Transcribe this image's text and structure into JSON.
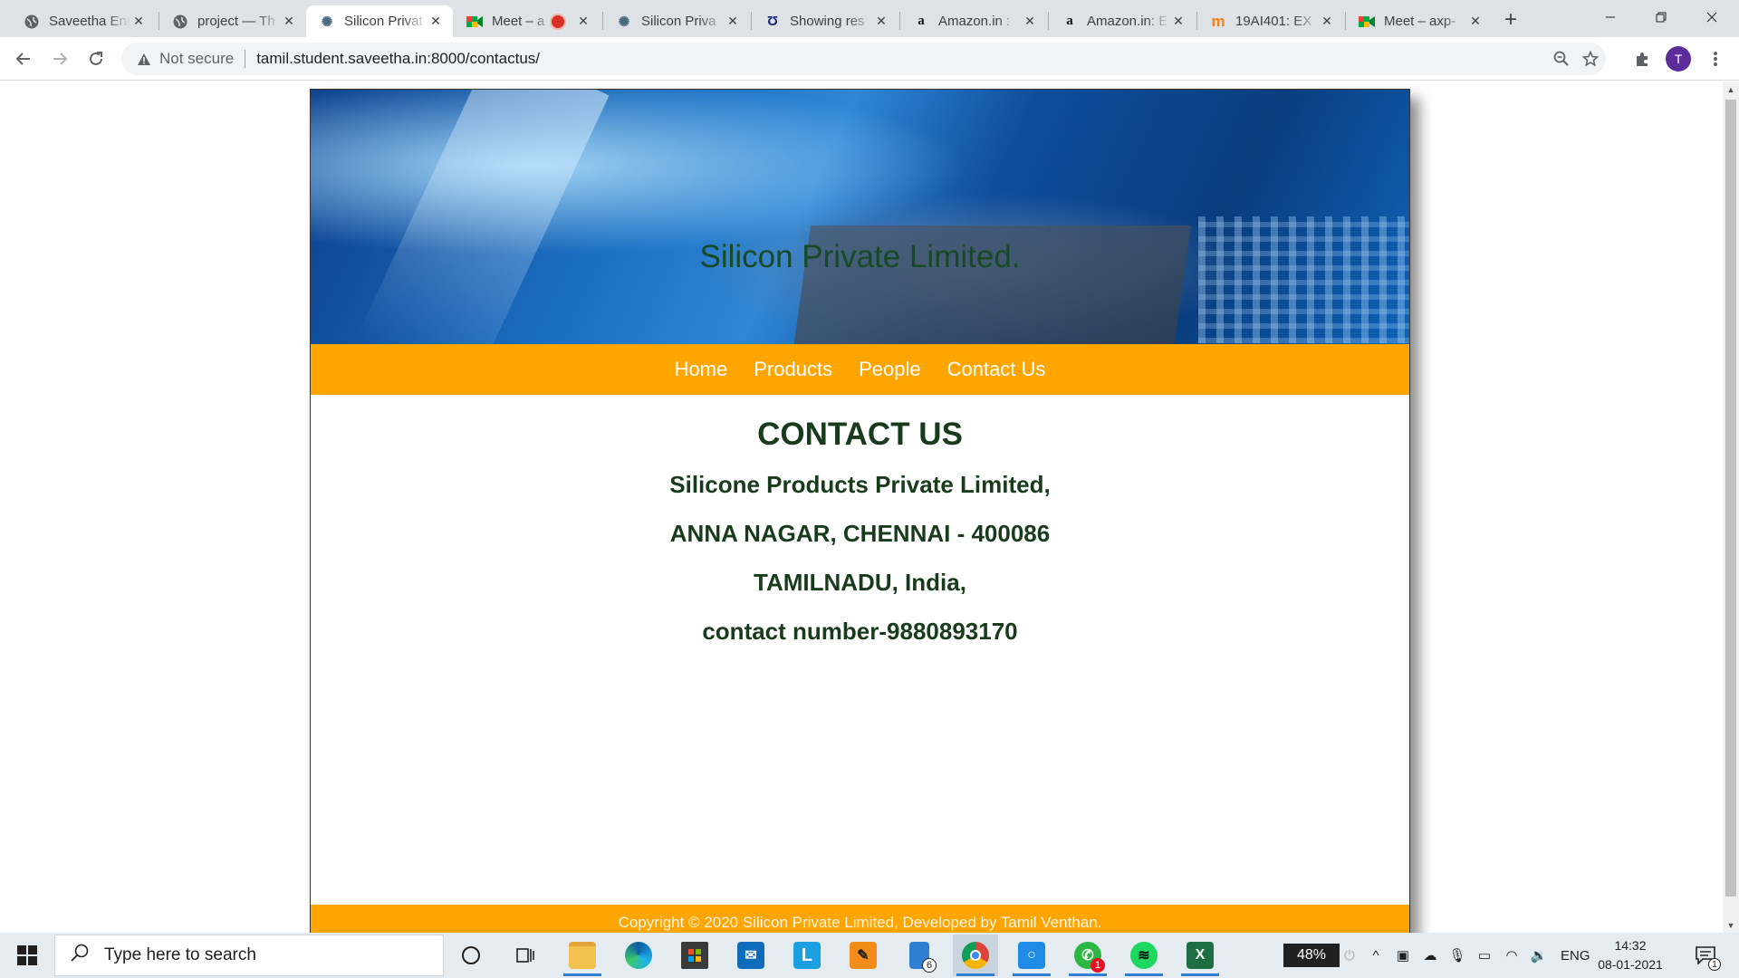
{
  "browser": {
    "tabs": [
      {
        "title": "Saveetha Eng",
        "favicon": "globe-icon",
        "active": false
      },
      {
        "title": "project — Th",
        "favicon": "globe-icon",
        "active": false
      },
      {
        "title": "Silicon Privat",
        "favicon": "gear-favicon-icon",
        "active": true
      },
      {
        "title": "Meet – a",
        "favicon": "meet-icon",
        "active": false,
        "recording": true
      },
      {
        "title": "Silicon Priva",
        "favicon": "gear-favicon-icon",
        "active": false
      },
      {
        "title": "Showing res",
        "favicon": "search-favicon-icon",
        "active": false
      },
      {
        "title": "Amazon.in :",
        "favicon": "amazon-icon",
        "active": false
      },
      {
        "title": "Amazon.in: E",
        "favicon": "amazon-icon",
        "active": false
      },
      {
        "title": "19AI401: EX",
        "favicon": "moodle-icon",
        "active": false
      },
      {
        "title": "Meet – axp-",
        "favicon": "meet-icon",
        "active": false
      }
    ],
    "security_label": "Not secure",
    "url": "tamil.student.saveetha.in:8000/contactus/",
    "profile_initial": "T"
  },
  "site": {
    "brand": "Silicon Private Limited.",
    "nav": [
      "Home",
      "Products",
      "People",
      "Contact Us"
    ],
    "heading": "CONTACT US",
    "address_lines": [
      "Silicone Products Private Limited,",
      "ANNA NAGAR, CHENNAI - 400086",
      "TAMILNADU, India,",
      "contact number-9880893170"
    ],
    "footer": "Copyright © 2020 Silicon Private Limited, Developed by Tamil Venthan.",
    "colors": {
      "nav_bg": "#ffa500",
      "text_green": "#183b1c"
    }
  },
  "taskbar": {
    "search_placeholder": "Type here to search",
    "file_explorer_badge": "6",
    "whatsapp_badge": "1",
    "battery": "48%",
    "language": "ENG",
    "time": "14:32",
    "date": "08-01-2021",
    "notification_count": "1"
  }
}
